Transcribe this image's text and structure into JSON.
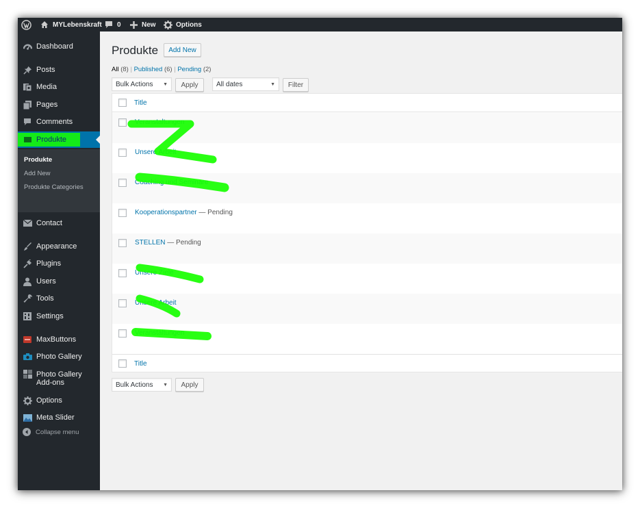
{
  "colors": {
    "adminbar": "#23282d",
    "sidebar": "#23282d",
    "submenu": "#32373c",
    "accent": "#0073aa",
    "highlighter": "#17ff00",
    "background": "#f1f1f1"
  },
  "adminbar": {
    "wp_logo_icon": "wordpress-logo-icon",
    "home_icon": "home-icon",
    "site_name": "MYLebenskraft",
    "comments_icon": "comment-bubble-icon",
    "comments_count": "0",
    "new_icon": "plus-icon",
    "new_label": "New",
    "options_icon": "gear-icon",
    "options_label": "Options"
  },
  "sidebar": {
    "items": [
      {
        "label": "Dashboard",
        "icon": "dashboard-icon"
      },
      {
        "label": "Posts",
        "icon": "pin-icon"
      },
      {
        "label": "Media",
        "icon": "media-icon"
      },
      {
        "label": "Pages",
        "icon": "pages-icon"
      },
      {
        "label": "Comments",
        "icon": "comment-icon"
      },
      {
        "label": "Produkte",
        "icon": "admin-post-icon",
        "current": true
      },
      {
        "label": "Contact",
        "icon": "envelope-icon"
      },
      {
        "label": "Appearance",
        "icon": "brush-icon"
      },
      {
        "label": "Plugins",
        "icon": "plugin-icon"
      },
      {
        "label": "Users",
        "icon": "user-icon"
      },
      {
        "label": "Tools",
        "icon": "wrench-icon"
      },
      {
        "label": "Settings",
        "icon": "settings-icon"
      },
      {
        "label": "MaxButtons",
        "icon": "maxbuttons-icon"
      },
      {
        "label": "Photo Gallery",
        "icon": "camera-icon"
      },
      {
        "label": "Photo Gallery Add-ons",
        "icon": "gallery-addons-icon"
      },
      {
        "label": "Options",
        "icon": "gear-icon"
      },
      {
        "label": "Meta Slider",
        "icon": "slider-icon"
      }
    ],
    "submenu": [
      {
        "label": "Produkte",
        "active": true
      },
      {
        "label": "Add New"
      },
      {
        "label": "Produkte Categories"
      }
    ],
    "collapse_label": "Collapse menu",
    "collapse_icon": "collapse-arrow-icon"
  },
  "page": {
    "title": "Produkte",
    "add_new_label": "Add New",
    "filters": {
      "all_label": "All",
      "all_count": "(8)",
      "published_label": "Published",
      "published_count": "(6)",
      "pending_label": "Pending",
      "pending_count": "(2)",
      "separator": "|"
    },
    "bulk_actions_label": "Bulk Actions",
    "apply_label": "Apply",
    "dates_label": "All dates",
    "filter_label": "Filter",
    "column_title": "Title",
    "rows": [
      {
        "title": "Veranstaltungen",
        "state": ""
      },
      {
        "title": "Unsere Arbeit",
        "state": ""
      },
      {
        "title": "Coaching und Seminare",
        "state": ""
      },
      {
        "title": "Kooperationspartner",
        "state": " — Pending"
      },
      {
        "title": "STELLEN",
        "state": " — Pending"
      },
      {
        "title": "Unsere Ziele",
        "state": ""
      },
      {
        "title": "Unsere Arbeit",
        "state": ""
      },
      {
        "title": "Veranstaltungen",
        "state": ""
      }
    ]
  }
}
